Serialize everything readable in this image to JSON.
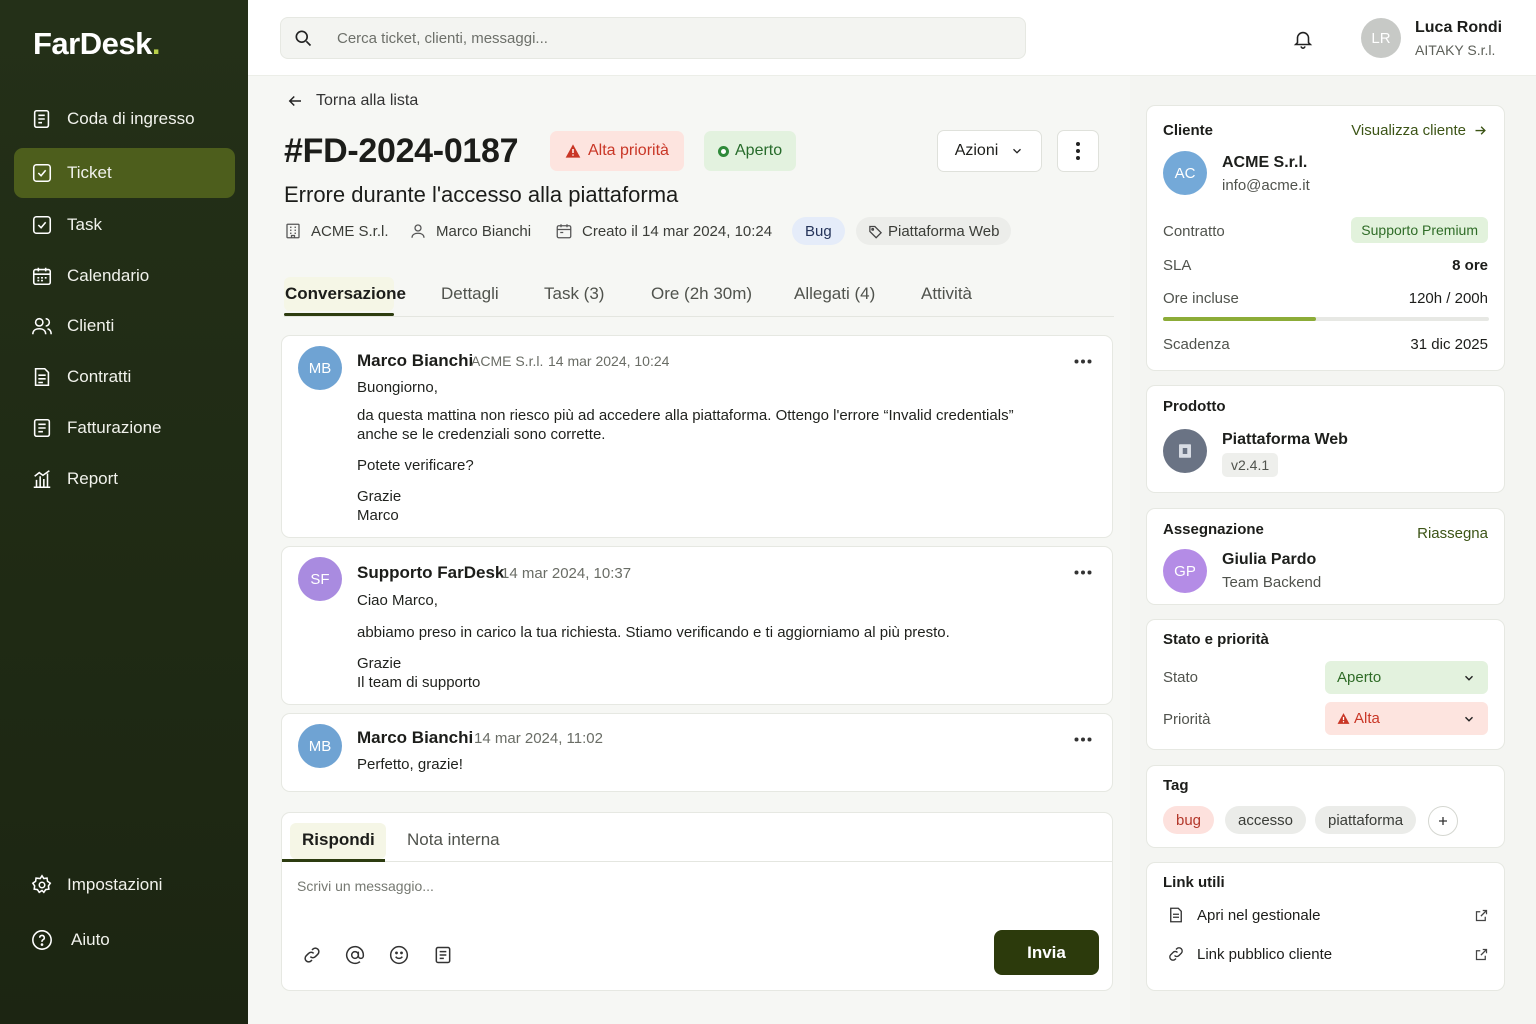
{
  "app": {
    "logo": "FarDesk",
    "logo_dot": "."
  },
  "sidebar": {
    "items": [
      {
        "label": "Coda di ingresso",
        "icon": "inbox-icon"
      },
      {
        "label": "Ticket",
        "icon": "ticket-icon",
        "active": true
      },
      {
        "label": "Task",
        "icon": "checkbox-icon"
      },
      {
        "label": "Calendario",
        "icon": "calendar-icon"
      },
      {
        "label": "Clienti",
        "icon": "users-icon"
      },
      {
        "label": "Contratti",
        "icon": "document-icon"
      },
      {
        "label": "Fatturazione",
        "icon": "invoice-icon"
      },
      {
        "label": "Report",
        "icon": "chart-icon"
      }
    ],
    "settings": "Impostazioni",
    "help": "Aiuto"
  },
  "topbar": {
    "search_placeholder": "Cerca ticket, clienti, messaggi...",
    "user": {
      "initials": "LR",
      "name": "Luca Rondi",
      "org": "AITAKY S.r.l."
    }
  },
  "ticket": {
    "back": "Torna alla lista",
    "id": "#FD-2024-0187",
    "priority_badge": "Alta priorità",
    "status_badge": "Aperto",
    "actions_label": "Azioni",
    "title": "Errore durante l'accesso alla piattaforma",
    "meta": {
      "company": "ACME S.r.l.",
      "contact": "Marco Bianchi",
      "created": "Creato il 14 mar 2024, 10:24",
      "category": "Bug",
      "product": "Piattaforma Web"
    },
    "tabs": [
      "Conversazione",
      "Dettagli",
      "Task (3)",
      "Ore (2h 30m)",
      "Allegati (4)",
      "Attività"
    ]
  },
  "messages": [
    {
      "initials": "MB",
      "author": "Marco Bianchi",
      "company": "ACME S.r.l.",
      "time": "14 mar 2024, 10:24",
      "lines": [
        "Buongiorno,",
        "da questa mattina non riesco più ad accedere alla piattaforma. Ottengo l'errore “Invalid credentials”",
        "anche se le credenziali sono corrette.",
        "Potete verificare?",
        "Grazie",
        "Marco"
      ]
    },
    {
      "initials": "SF",
      "author": "Supporto FarDesk",
      "time": "14 mar 2024, 10:37",
      "lines": [
        "Ciao Marco,",
        "abbiamo preso in carico la tua richiesta. Stiamo verificando e ti aggiorniamo al più presto.",
        "Grazie",
        "Il team di supporto"
      ]
    },
    {
      "initials": "MB",
      "author": "Marco Bianchi",
      "time": "14 mar 2024, 11:02",
      "lines": [
        "Perfetto, grazie!"
      ]
    }
  ],
  "reply": {
    "tab_reply": "Rispondi",
    "tab_note": "Nota interna",
    "placeholder": "Scrivi un messaggio...",
    "send": "Invia"
  },
  "panel": {
    "client": {
      "title": "Cliente",
      "view_link": "Visualizza cliente",
      "initials": "AC",
      "name": "ACME S.r.l.",
      "email": "info@acme.it",
      "contract_label": "Contratto",
      "contract_value": "Supporto Premium",
      "sla_label": "SLA",
      "sla_value": "8 ore",
      "hours_label": "Ore incluse",
      "hours_value": "120h / 200h",
      "hours_fraction": 0.47,
      "deadline_label": "Scadenza",
      "deadline_value": "31 dic 2025"
    },
    "product": {
      "title": "Prodotto",
      "name": "Piattaforma Web",
      "version": "v2.4.1"
    },
    "assignment": {
      "title": "Assegnazione",
      "reassign": "Riassegna",
      "initials": "GP",
      "name": "Giulia Pardo",
      "team": "Team Backend"
    },
    "status": {
      "title": "Stato e priorità",
      "status_label": "Stato",
      "status_value": "Aperto",
      "priority_label": "Priorità",
      "priority_value": "Alta"
    },
    "tags": {
      "title": "Tag",
      "items": [
        "bug",
        "accesso",
        "piattaforma"
      ]
    },
    "links": {
      "title": "Link utili",
      "items": [
        "Apri nel gestionale",
        "Link pubblico cliente"
      ]
    }
  },
  "colors": {
    "sidebar": "#243018",
    "accent": "#2c3a0c",
    "active_nav": "#4d5e1c",
    "priority": "#c93626",
    "open": "#2f8a3a"
  }
}
